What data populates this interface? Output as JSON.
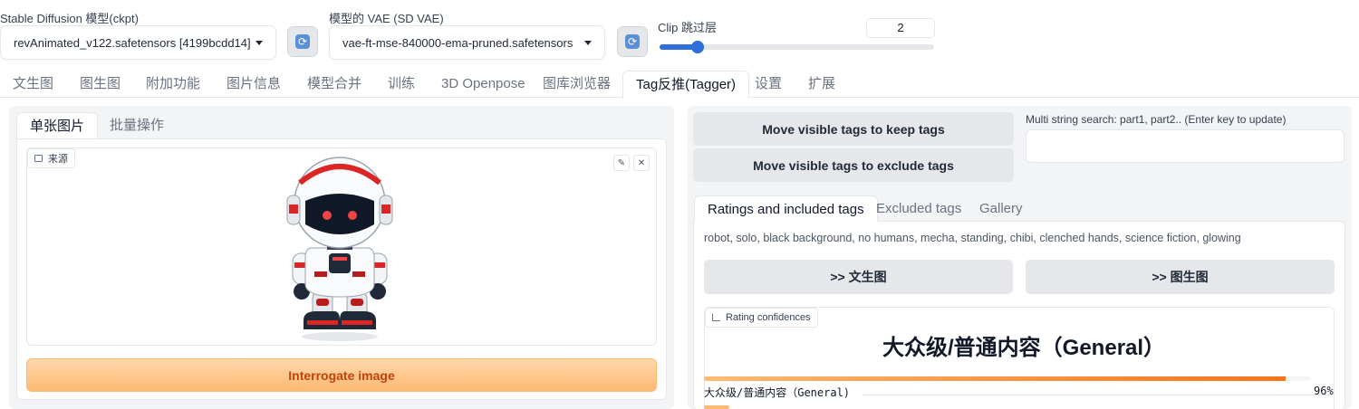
{
  "settings": {
    "checkpoint_label": "Stable Diffusion 模型(ckpt)",
    "checkpoint_value": "revAnimated_v122.safetensors [4199bcdd14]",
    "vae_label": "模型的 VAE (SD VAE)",
    "vae_value": "vae-ft-mse-840000-ema-pruned.safetensors",
    "clip_label": "Clip 跳过层",
    "clip_value": "2",
    "clip_slider_fraction": 0.14
  },
  "main_tabs": [
    "文生图",
    "图生图",
    "附加功能",
    "图片信息",
    "模型合并",
    "训练",
    "3D Openpose",
    "图库浏览器",
    "Tag反推(Tagger)",
    "设置",
    "扩展"
  ],
  "main_tabs_active": "Tag反推(Tagger)",
  "left": {
    "tabs": [
      "单张图片",
      "批量操作"
    ],
    "source_label": "来源",
    "image_alt": "robot",
    "interrogate_label": "Interrogate image"
  },
  "right": {
    "keep_button": "Move visible tags to keep tags",
    "exclude_button": "Move visible tags to exclude tags",
    "search_label": "Multi string search: part1, part2.. (Enter key to update)",
    "search_value": "",
    "result_tabs": [
      "Ratings and included tags",
      "Excluded tags",
      "Gallery"
    ],
    "tags": "robot, solo, black background, no humans, mecha, standing, chibi, clenched hands, science fiction, glowing",
    "send_txt2img": ">> 文生图",
    "send_img2img": ">> 图生图",
    "rating_label": "Rating confidences",
    "rating_top": "大众级/普通内容（General）",
    "rating_rows": [
      {
        "name": "大众级/普通内容（General)",
        "pct": "96%",
        "value": 0.96
      }
    ]
  },
  "colors": {
    "accent": "#2f6fdb",
    "orange": "#f97316"
  }
}
